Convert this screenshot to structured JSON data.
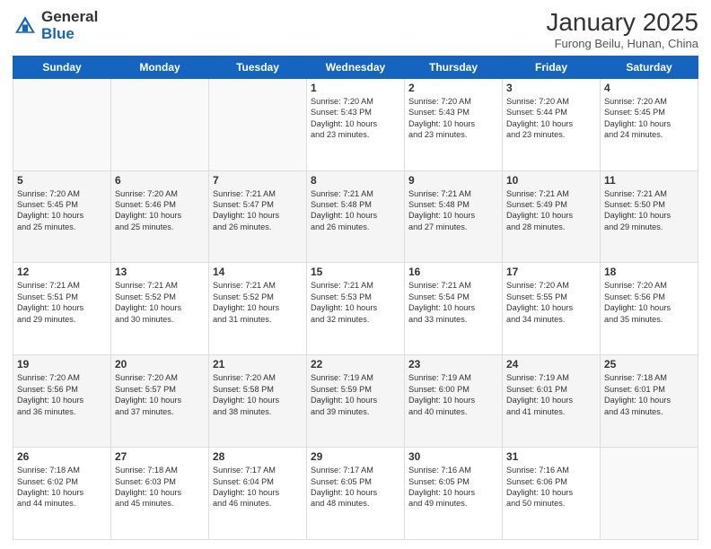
{
  "header": {
    "logo_general": "General",
    "logo_blue": "Blue",
    "month_title": "January 2025",
    "subtitle": "Furong Beilu, Hunan, China"
  },
  "weekdays": [
    "Sunday",
    "Monday",
    "Tuesday",
    "Wednesday",
    "Thursday",
    "Friday",
    "Saturday"
  ],
  "weeks": [
    [
      {
        "day": "",
        "text": ""
      },
      {
        "day": "",
        "text": ""
      },
      {
        "day": "",
        "text": ""
      },
      {
        "day": "1",
        "text": "Sunrise: 7:20 AM\nSunset: 5:43 PM\nDaylight: 10 hours\nand 23 minutes."
      },
      {
        "day": "2",
        "text": "Sunrise: 7:20 AM\nSunset: 5:43 PM\nDaylight: 10 hours\nand 23 minutes."
      },
      {
        "day": "3",
        "text": "Sunrise: 7:20 AM\nSunset: 5:44 PM\nDaylight: 10 hours\nand 23 minutes."
      },
      {
        "day": "4",
        "text": "Sunrise: 7:20 AM\nSunset: 5:45 PM\nDaylight: 10 hours\nand 24 minutes."
      }
    ],
    [
      {
        "day": "5",
        "text": "Sunrise: 7:20 AM\nSunset: 5:45 PM\nDaylight: 10 hours\nand 25 minutes."
      },
      {
        "day": "6",
        "text": "Sunrise: 7:20 AM\nSunset: 5:46 PM\nDaylight: 10 hours\nand 25 minutes."
      },
      {
        "day": "7",
        "text": "Sunrise: 7:21 AM\nSunset: 5:47 PM\nDaylight: 10 hours\nand 26 minutes."
      },
      {
        "day": "8",
        "text": "Sunrise: 7:21 AM\nSunset: 5:48 PM\nDaylight: 10 hours\nand 26 minutes."
      },
      {
        "day": "9",
        "text": "Sunrise: 7:21 AM\nSunset: 5:48 PM\nDaylight: 10 hours\nand 27 minutes."
      },
      {
        "day": "10",
        "text": "Sunrise: 7:21 AM\nSunset: 5:49 PM\nDaylight: 10 hours\nand 28 minutes."
      },
      {
        "day": "11",
        "text": "Sunrise: 7:21 AM\nSunset: 5:50 PM\nDaylight: 10 hours\nand 29 minutes."
      }
    ],
    [
      {
        "day": "12",
        "text": "Sunrise: 7:21 AM\nSunset: 5:51 PM\nDaylight: 10 hours\nand 29 minutes."
      },
      {
        "day": "13",
        "text": "Sunrise: 7:21 AM\nSunset: 5:52 PM\nDaylight: 10 hours\nand 30 minutes."
      },
      {
        "day": "14",
        "text": "Sunrise: 7:21 AM\nSunset: 5:52 PM\nDaylight: 10 hours\nand 31 minutes."
      },
      {
        "day": "15",
        "text": "Sunrise: 7:21 AM\nSunset: 5:53 PM\nDaylight: 10 hours\nand 32 minutes."
      },
      {
        "day": "16",
        "text": "Sunrise: 7:21 AM\nSunset: 5:54 PM\nDaylight: 10 hours\nand 33 minutes."
      },
      {
        "day": "17",
        "text": "Sunrise: 7:20 AM\nSunset: 5:55 PM\nDaylight: 10 hours\nand 34 minutes."
      },
      {
        "day": "18",
        "text": "Sunrise: 7:20 AM\nSunset: 5:56 PM\nDaylight: 10 hours\nand 35 minutes."
      }
    ],
    [
      {
        "day": "19",
        "text": "Sunrise: 7:20 AM\nSunset: 5:56 PM\nDaylight: 10 hours\nand 36 minutes."
      },
      {
        "day": "20",
        "text": "Sunrise: 7:20 AM\nSunset: 5:57 PM\nDaylight: 10 hours\nand 37 minutes."
      },
      {
        "day": "21",
        "text": "Sunrise: 7:20 AM\nSunset: 5:58 PM\nDaylight: 10 hours\nand 38 minutes."
      },
      {
        "day": "22",
        "text": "Sunrise: 7:19 AM\nSunset: 5:59 PM\nDaylight: 10 hours\nand 39 minutes."
      },
      {
        "day": "23",
        "text": "Sunrise: 7:19 AM\nSunset: 6:00 PM\nDaylight: 10 hours\nand 40 minutes."
      },
      {
        "day": "24",
        "text": "Sunrise: 7:19 AM\nSunset: 6:01 PM\nDaylight: 10 hours\nand 41 minutes."
      },
      {
        "day": "25",
        "text": "Sunrise: 7:18 AM\nSunset: 6:01 PM\nDaylight: 10 hours\nand 43 minutes."
      }
    ],
    [
      {
        "day": "26",
        "text": "Sunrise: 7:18 AM\nSunset: 6:02 PM\nDaylight: 10 hours\nand 44 minutes."
      },
      {
        "day": "27",
        "text": "Sunrise: 7:18 AM\nSunset: 6:03 PM\nDaylight: 10 hours\nand 45 minutes."
      },
      {
        "day": "28",
        "text": "Sunrise: 7:17 AM\nSunset: 6:04 PM\nDaylight: 10 hours\nand 46 minutes."
      },
      {
        "day": "29",
        "text": "Sunrise: 7:17 AM\nSunset: 6:05 PM\nDaylight: 10 hours\nand 48 minutes."
      },
      {
        "day": "30",
        "text": "Sunrise: 7:16 AM\nSunset: 6:05 PM\nDaylight: 10 hours\nand 49 minutes."
      },
      {
        "day": "31",
        "text": "Sunrise: 7:16 AM\nSunset: 6:06 PM\nDaylight: 10 hours\nand 50 minutes."
      },
      {
        "day": "",
        "text": ""
      }
    ]
  ]
}
